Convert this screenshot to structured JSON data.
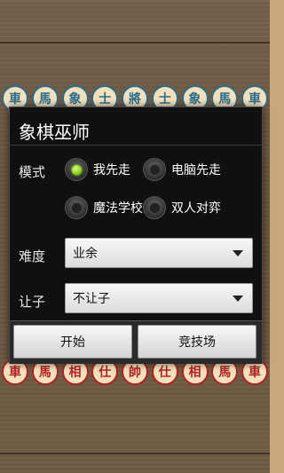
{
  "board": {
    "top_pieces": [
      "車",
      "馬",
      "象",
      "士",
      "將",
      "士",
      "象",
      "馬",
      "車"
    ],
    "bottom_pieces": [
      "車",
      "馬",
      "相",
      "仕",
      "帥",
      "仕",
      "相",
      "馬",
      "車"
    ]
  },
  "dialog": {
    "title": "象棋巫师",
    "mode": {
      "label": "模式",
      "options": [
        {
          "label": "我先走",
          "checked": true
        },
        {
          "label": "电脑先走",
          "checked": false
        },
        {
          "label": "魔法学校",
          "checked": false
        },
        {
          "label": "双人对弈",
          "checked": false
        }
      ]
    },
    "difficulty": {
      "label": "难度",
      "value": "业余"
    },
    "handicap": {
      "label": "让子",
      "value": "不让子"
    },
    "buttons": {
      "start": "开始",
      "arena": "竞技场"
    }
  },
  "colors": {
    "checked_radio": "#7fc315",
    "dialog_bg": "#101010"
  }
}
